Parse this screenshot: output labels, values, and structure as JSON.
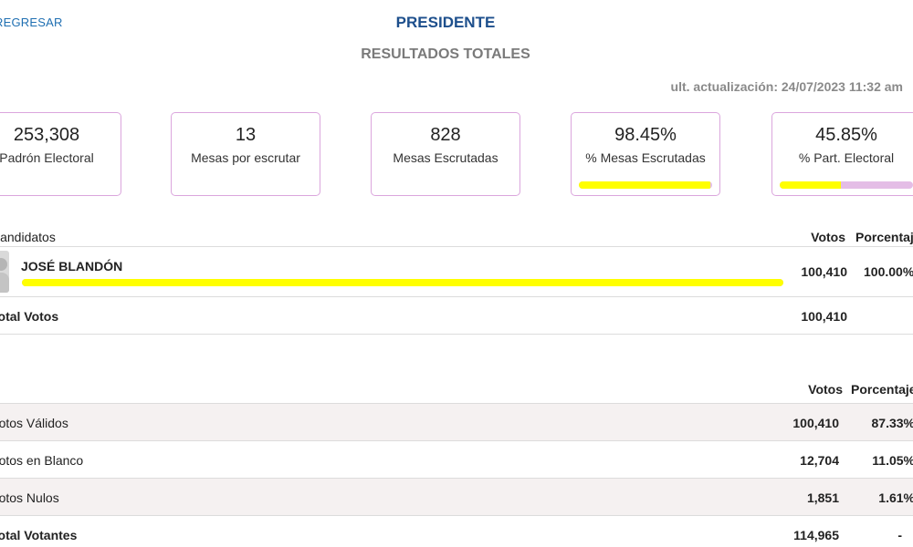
{
  "header": {
    "back_label": "REGRESAR",
    "title": "PRESIDENTE",
    "subtitle": "RESULTADOS TOTALES",
    "updated": "ult. actualización: 24/07/2023 11:32 am"
  },
  "cards": [
    {
      "value": "253,308",
      "label": "Padrón Electoral"
    },
    {
      "value": "13",
      "label": "Mesas por escrutar"
    },
    {
      "value": "828",
      "label": "Mesas Escrutadas"
    },
    {
      "value": "98.45%",
      "label": "% Mesas Escrutadas",
      "progress_percent": 98.45
    },
    {
      "value": "45.85%",
      "label": "% Part. Electoral",
      "progress_percent": 45.85
    }
  ],
  "candidates_table": {
    "col_candidates": "Candidatos",
    "col_votes": "Votos",
    "col_percent": "Porcentaje",
    "rows": [
      {
        "name": "JOSÉ BLANDÓN",
        "votes": "100,410",
        "percent": "100.00%",
        "percent_value": 100
      }
    ],
    "total_label": "Total Votos",
    "total_votes": "100,410"
  },
  "summary_table": {
    "col_votes": "Votos",
    "col_percent": "Porcentaje",
    "rows": [
      {
        "label": "Votos Válidos",
        "votes": "100,410",
        "percent": "87.33%"
      },
      {
        "label": "Votos en Blanco",
        "votes": "12,704",
        "percent": "11.05%"
      },
      {
        "label": "Votos Nulos",
        "votes": "1,851",
        "percent": "1.61%"
      },
      {
        "label": "Total Votantes",
        "votes": "114,965",
        "percent": "-"
      }
    ]
  },
  "colors": {
    "accent_title": "#1d4f8c",
    "link": "#1f6fb2",
    "card_border": "#dba6dd",
    "bar_fill": "#ffff00",
    "bar_track": "#e4bde6"
  }
}
